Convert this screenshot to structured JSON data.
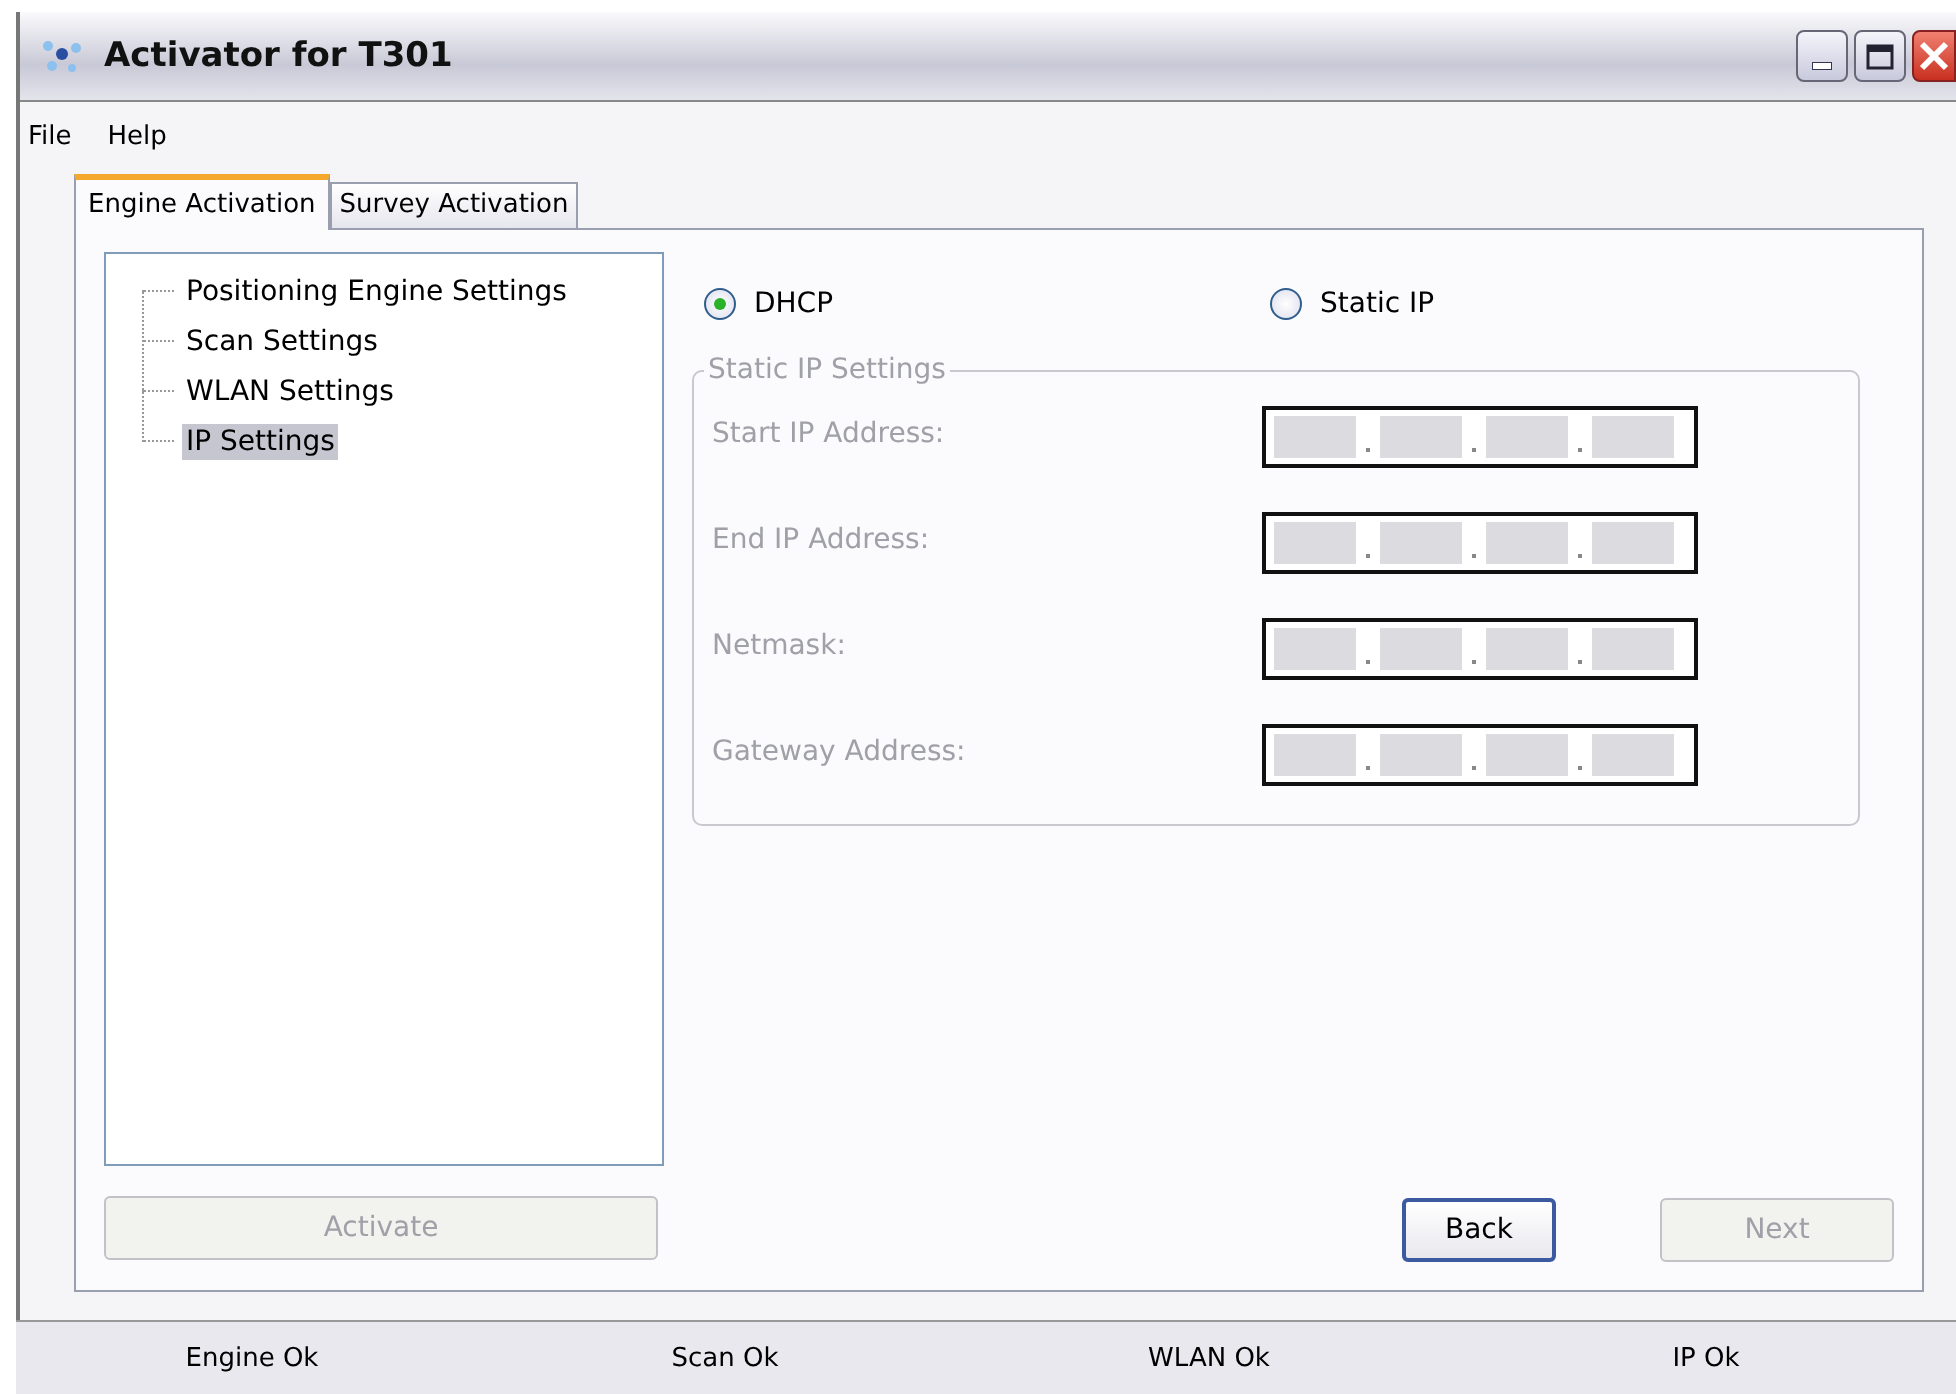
{
  "window": {
    "title": "Activator for T301"
  },
  "menu": [
    "File",
    "Help"
  ],
  "tabs": [
    {
      "label": "Engine Activation",
      "selected": true
    },
    {
      "label": "Survey Activation",
      "selected": false
    }
  ],
  "tree": {
    "items": [
      {
        "label": "Positioning Engine Settings",
        "selected": false
      },
      {
        "label": "Scan Settings",
        "selected": false
      },
      {
        "label": "WLAN Settings",
        "selected": false
      },
      {
        "label": "IP Settings",
        "selected": true
      }
    ]
  },
  "mode": [
    {
      "label": "DHCP",
      "selected": true
    },
    {
      "label": "Static IP",
      "selected": false
    }
  ],
  "static_ip": {
    "title": "Static IP Settings",
    "disabled": true,
    "fields": [
      {
        "label": "Start IP Address:"
      },
      {
        "label": "End IP Address:"
      },
      {
        "label": "Netmask:"
      },
      {
        "label": "Gateway Address:"
      }
    ]
  },
  "buttons": {
    "activate": {
      "label": "Activate",
      "disabled": true
    },
    "back": {
      "label": "Back",
      "disabled": false,
      "focused": true
    },
    "next": {
      "label": "Next",
      "disabled": true,
      "focused": false
    }
  },
  "status_bar": [
    "Engine Ok",
    "Scan Ok",
    "WLAN Ok",
    "IP Ok"
  ]
}
